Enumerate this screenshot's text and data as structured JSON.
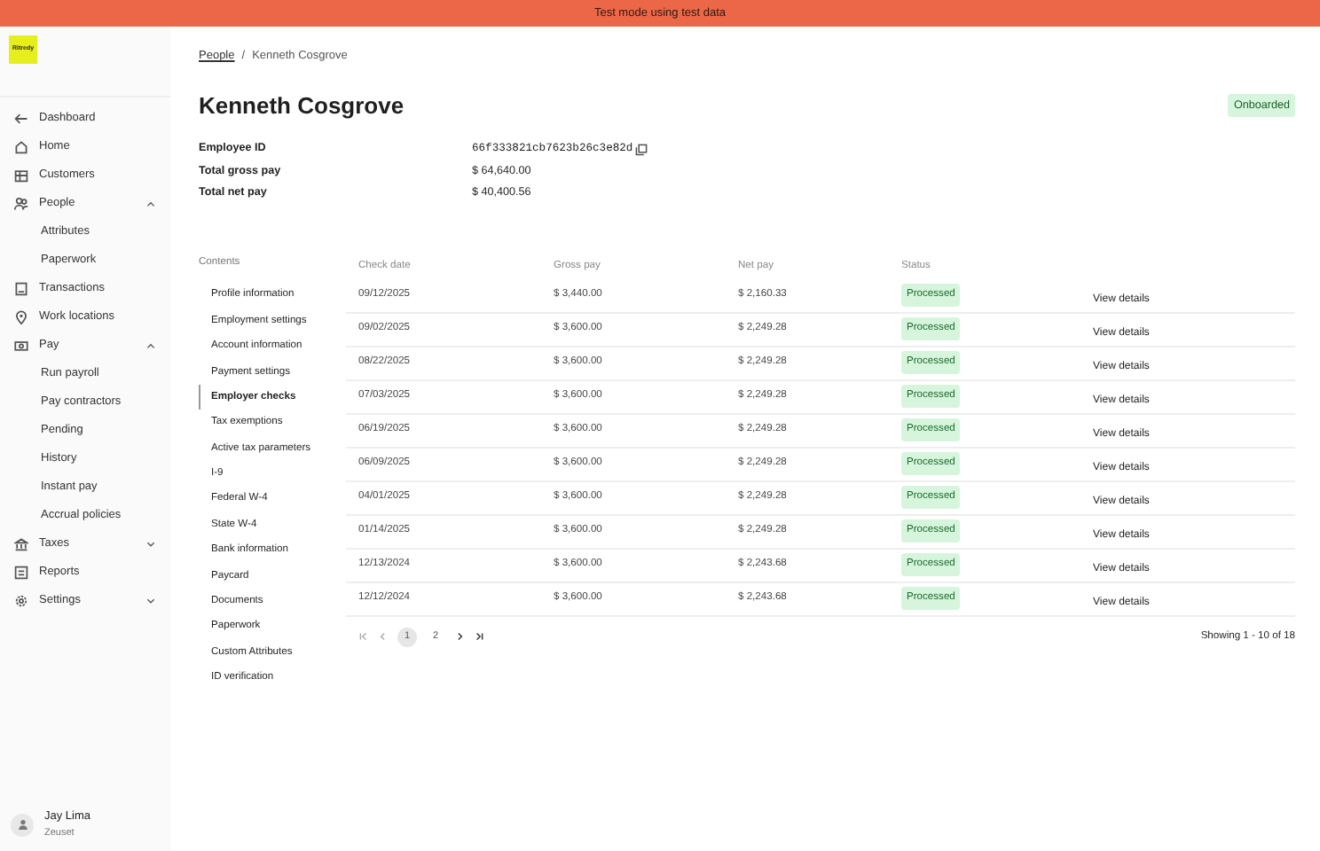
{
  "banner": "Test mode using test data",
  "logo": "Ritredy",
  "sidebar": {
    "items": [
      {
        "label": "Dashboard"
      },
      {
        "label": "Home"
      },
      {
        "label": "Customers"
      },
      {
        "label": "People",
        "expanded": true,
        "children": [
          {
            "label": "Attributes"
          },
          {
            "label": "Paperwork"
          }
        ]
      },
      {
        "label": "Transactions"
      },
      {
        "label": "Work locations"
      },
      {
        "label": "Pay",
        "expanded": true,
        "children": [
          {
            "label": "Run payroll"
          },
          {
            "label": "Pay contractors"
          },
          {
            "label": "Pending"
          },
          {
            "label": "History"
          },
          {
            "label": "Instant pay"
          },
          {
            "label": "Accrual policies"
          }
        ]
      },
      {
        "label": "Taxes",
        "expanded": false
      },
      {
        "label": "Reports"
      },
      {
        "label": "Settings",
        "expanded": false
      }
    ],
    "user": {
      "name": "Jay Lima",
      "org": "Zeuset"
    }
  },
  "breadcrumb": [
    "People",
    "Kenneth Cosgrove"
  ],
  "breadcrumb_separator": "/",
  "title": "Kenneth Cosgrove",
  "status_badge": "Onboarded",
  "details": [
    {
      "label": "Employee ID",
      "value": "66f333821cb7623b26c3e82d",
      "copy": true
    },
    {
      "label": "Total gross pay",
      "value": "$ 64,640.00"
    },
    {
      "label": "Total net pay",
      "value": "$ 40,400.56"
    }
  ],
  "contents": {
    "heading": "Contents",
    "items": [
      {
        "label": "Profile information",
        "selected": false
      },
      {
        "label": "Employment settings",
        "selected": false
      },
      {
        "label": "Account information",
        "selected": false
      },
      {
        "label": "Payment settings",
        "selected": false
      },
      {
        "label": "Employer checks",
        "selected": true
      },
      {
        "label": "Tax exemptions",
        "selected": false
      },
      {
        "label": "Active tax parameters",
        "selected": false
      },
      {
        "label": "I-9",
        "selected": false
      },
      {
        "label": "Federal W-4",
        "selected": false
      },
      {
        "label": "State W-4",
        "selected": false
      },
      {
        "label": "Bank information",
        "selected": false
      },
      {
        "label": "Paycard",
        "selected": false
      },
      {
        "label": "Documents",
        "selected": false
      },
      {
        "label": "Paperwork",
        "selected": false
      },
      {
        "label": "Custom Attributes",
        "selected": false
      },
      {
        "label": "ID verification",
        "selected": false
      }
    ]
  },
  "table": {
    "columns": [
      "Check date",
      "Gross pay",
      "Net pay",
      "Status"
    ],
    "rows": [
      {
        "date": "09/12/2025",
        "gross": "$ 3,440.00",
        "net": "$ 2,160.33",
        "status": "Processed",
        "action": "View details"
      },
      {
        "date": "09/02/2025",
        "gross": "$ 3,600.00",
        "net": "$ 2,249.28",
        "status": "Processed",
        "action": "View details"
      },
      {
        "date": "08/22/2025",
        "gross": "$ 3,600.00",
        "net": "$ 2,249.28",
        "status": "Processed",
        "action": "View details"
      },
      {
        "date": "07/03/2025",
        "gross": "$ 3,600.00",
        "net": "$ 2,249.28",
        "status": "Processed",
        "action": "View details"
      },
      {
        "date": "06/19/2025",
        "gross": "$ 3,600.00",
        "net": "$ 2,249.28",
        "status": "Processed",
        "action": "View details"
      },
      {
        "date": "06/09/2025",
        "gross": "$ 3,600.00",
        "net": "$ 2,249.28",
        "status": "Processed",
        "action": "View details"
      },
      {
        "date": "04/01/2025",
        "gross": "$ 3,600.00",
        "net": "$ 2,249.28",
        "status": "Processed",
        "action": "View details"
      },
      {
        "date": "01/14/2025",
        "gross": "$ 3,600.00",
        "net": "$ 2,249.28",
        "status": "Processed",
        "action": "View details"
      },
      {
        "date": "12/13/2024",
        "gross": "$ 3,600.00",
        "net": "$ 2,243.68",
        "status": "Processed",
        "action": "View details"
      },
      {
        "date": "12/12/2024",
        "gross": "$ 3,600.00",
        "net": "$ 2,243.68",
        "status": "Processed",
        "action": "View details"
      }
    ]
  },
  "pagination": {
    "pages": [
      {
        "label": "1",
        "selected": true
      },
      {
        "label": "2",
        "selected": false
      }
    ],
    "summary": "Showing 1 - 10 of 18"
  }
}
